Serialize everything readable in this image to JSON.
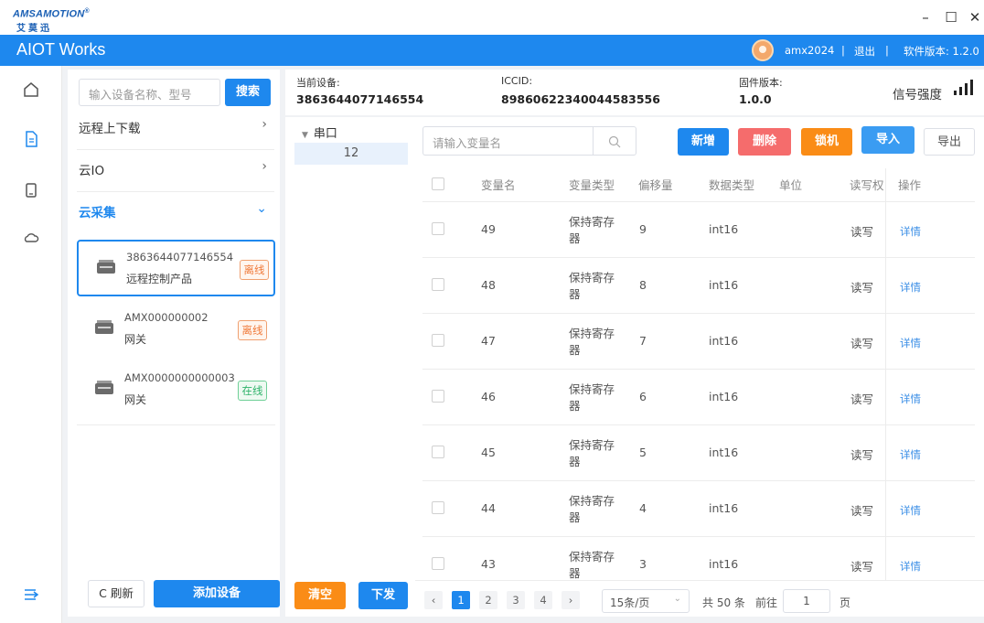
{
  "brand": {
    "logo_top": "AMSAMOTION",
    "logo_reg": "®",
    "logo_bottom": "艾莫迅"
  },
  "window_controls": {
    "minimize": "–",
    "maximize": "☐",
    "close": "✕"
  },
  "header": {
    "app_title": "AIOT Works",
    "user_name": "amx2024",
    "separator": "|",
    "logout": "退出",
    "version": "软件版本: 1.2.0"
  },
  "device_panel": {
    "search_placeholder": "输入设备名称、型号",
    "search_button": "搜索",
    "categories": [
      {
        "label": "远程上下载",
        "arrow": "›"
      },
      {
        "label": "云IO",
        "arrow": "›"
      },
      {
        "label": "云采集",
        "arrow": "⌄"
      }
    ],
    "devices": [
      {
        "id": "3863644077146554",
        "type": "远程控制产品",
        "status": "离线"
      },
      {
        "id": "AMX000000002",
        "type": "网关",
        "status": "离线"
      },
      {
        "id": "AMX0000000000003",
        "type": "网关",
        "status": "在线"
      }
    ],
    "refresh_button": "C 刷新",
    "add_button": "添加设备"
  },
  "info": {
    "current_device_label": "当前设备:",
    "current_device": "3863644077146554",
    "iccid_label": "ICCID:",
    "iccid": "89860622340044583556",
    "firmware_label": "固件版本:",
    "firmware": "1.0.0",
    "signal_label": "信号强度"
  },
  "tree": {
    "root": "串口",
    "child": "12",
    "clear_button": "清空",
    "push_button": "下发"
  },
  "toolbar": {
    "search_placeholder": "请输入变量名",
    "add": "新增",
    "delete": "删除",
    "lock": "锁机",
    "import": "导入",
    "export": "导出"
  },
  "table": {
    "headers": [
      "变量名",
      "变量类型",
      "偏移量",
      "数据类型",
      "单位",
      "读写权",
      "操作"
    ],
    "rows": [
      {
        "name": "49",
        "type_line1": "保持寄存",
        "type_line2": "器",
        "offset": "9",
        "dtype": "int16",
        "unit": "",
        "rw": "读写",
        "action": "详情"
      },
      {
        "name": "48",
        "type_line1": "保持寄存",
        "type_line2": "器",
        "offset": "8",
        "dtype": "int16",
        "unit": "",
        "rw": "读写",
        "action": "详情"
      },
      {
        "name": "47",
        "type_line1": "保持寄存",
        "type_line2": "器",
        "offset": "7",
        "dtype": "int16",
        "unit": "",
        "rw": "读写",
        "action": "详情"
      },
      {
        "name": "46",
        "type_line1": "保持寄存",
        "type_line2": "器",
        "offset": "6",
        "dtype": "int16",
        "unit": "",
        "rw": "读写",
        "action": "详情"
      },
      {
        "name": "45",
        "type_line1": "保持寄存",
        "type_line2": "器",
        "offset": "5",
        "dtype": "int16",
        "unit": "",
        "rw": "读写",
        "action": "详情"
      },
      {
        "name": "44",
        "type_line1": "保持寄存",
        "type_line2": "器",
        "offset": "4",
        "dtype": "int16",
        "unit": "",
        "rw": "读写",
        "action": "详情"
      },
      {
        "name": "43",
        "type_line1": "保持寄存",
        "type_line2": "器",
        "offset": "3",
        "dtype": "int16",
        "unit": "",
        "rw": "读写",
        "action": "详情"
      }
    ]
  },
  "pagination": {
    "prev": "‹",
    "pages": [
      "1",
      "2",
      "3",
      "4"
    ],
    "next": "›",
    "page_size": "15条/页",
    "total": "共 50 条",
    "goto_label": "前往",
    "goto_value": "1",
    "page_unit": "页"
  },
  "colors": {
    "primary": "#1e88ee",
    "danger": "#f56c6c",
    "warning": "#fa8c16",
    "offline": "#f07a3a",
    "online": "#2fb36b"
  }
}
